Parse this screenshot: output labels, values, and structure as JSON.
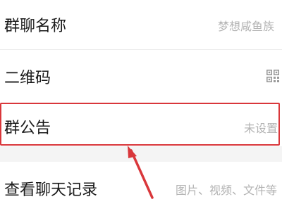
{
  "settings": {
    "group_name": {
      "label": "群聊名称",
      "value": "梦想咸鱼族"
    },
    "qr_code": {
      "label": "二维码",
      "icon": "qr-code-icon"
    },
    "announcement": {
      "label": "群公告",
      "value": "未设置"
    },
    "chat_history": {
      "label": "查看聊天记录",
      "value": "图片、视频、文件等"
    }
  },
  "colors": {
    "highlight": "#d9373b",
    "label": "#1a1a1a",
    "value": "#b3b3b3",
    "divider": "#ececec",
    "section_gap": "#f4f4f4"
  },
  "annotation": {
    "icon": "arrow-icon"
  }
}
